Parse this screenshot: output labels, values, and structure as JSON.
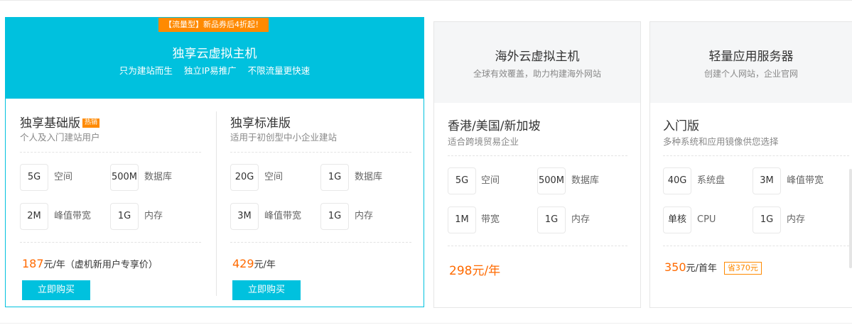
{
  "card1": {
    "promo": "【流量型】新品券后4折起！",
    "title": "独享云虚拟主机",
    "tags": [
      "只为建站而生",
      "独立IP易推广",
      "不限流量更快速"
    ],
    "plans": [
      {
        "name": "独享基础版",
        "badge": "热销",
        "desc": "个人及入门建站用户",
        "specs": [
          {
            "value": "5G",
            "label": "空间"
          },
          {
            "value": "500M",
            "label": "数据库"
          },
          {
            "value": "2M",
            "label": "峰值带宽"
          },
          {
            "value": "1G",
            "label": "内存"
          }
        ],
        "price": "187",
        "price_unit": "元/年（虚机新用户专享价）",
        "buy": "立即购买"
      },
      {
        "name": "独享标准版",
        "desc": "适用于初创型中小企业建站",
        "specs": [
          {
            "value": "20G",
            "label": "空间"
          },
          {
            "value": "1G",
            "label": "数据库"
          },
          {
            "value": "3M",
            "label": "峰值带宽"
          },
          {
            "value": "1G",
            "label": "内存"
          }
        ],
        "price": "429",
        "price_unit": "元/年",
        "buy": "立即购买"
      }
    ]
  },
  "card2": {
    "title": "海外云虚拟主机",
    "subtitle": "全球有效覆盖，助力构建海外网站",
    "plan": {
      "name": "香港/美国/新加坡",
      "desc": "适合跨境贸易企业",
      "specs": [
        {
          "value": "5G",
          "label": "空间"
        },
        {
          "value": "500M",
          "label": "数据库"
        },
        {
          "value": "1M",
          "label": "带宽"
        },
        {
          "value": "1G",
          "label": "内存"
        }
      ],
      "price": "298元/年"
    }
  },
  "card3": {
    "title": "轻量应用服务器",
    "subtitle": "创建个人网站，企业官网",
    "plan": {
      "name": "入门版",
      "desc": "多种系统和应用镜像供您选择",
      "specs": [
        {
          "value": "40G",
          "label": "系统盘"
        },
        {
          "value": "3M",
          "label": "峰值带宽"
        },
        {
          "value": "单核",
          "label": "CPU"
        },
        {
          "value": "1G",
          "label": "内存"
        }
      ],
      "price": "350",
      "price_unit": "元/首年",
      "save": "省370元"
    }
  }
}
